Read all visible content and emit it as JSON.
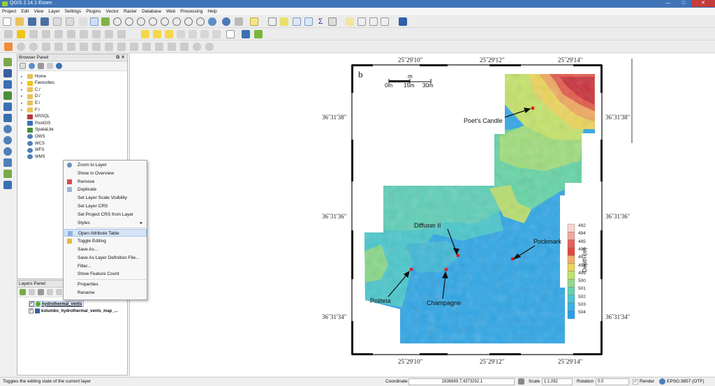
{
  "window": {
    "title": "QGIS 2.14.1-Essen",
    "min": "—",
    "max": "□",
    "close": "✕"
  },
  "menu": [
    "Project",
    "Edit",
    "View",
    "Layer",
    "Settings",
    "Plugins",
    "Vector",
    "Raster",
    "Database",
    "Web",
    "Processing",
    "Help"
  ],
  "browser_panel": {
    "title": "Browser Panel",
    "items": [
      {
        "label": "Home",
        "icon": "folder-icon",
        "color": "#e8c25a"
      },
      {
        "label": "Favourites",
        "icon": "star-icon",
        "color": "#f0c419"
      },
      {
        "label": "C:/",
        "icon": "folder-icon",
        "color": "#e8c25a"
      },
      {
        "label": "D:/",
        "icon": "folder-icon",
        "color": "#e8c25a"
      },
      {
        "label": "E:/",
        "icon": "folder-icon",
        "color": "#e8c25a"
      },
      {
        "label": "F:/",
        "icon": "folder-icon",
        "color": "#e8c25a"
      },
      {
        "label": "MSSQL",
        "icon": "database-icon",
        "color": "#b23a3a"
      },
      {
        "label": "PostGIS",
        "icon": "database-icon",
        "color": "#3a6fb2"
      },
      {
        "label": "SpatiaLite",
        "icon": "database-icon",
        "color": "#4a8f3a"
      },
      {
        "label": "OWS",
        "icon": "globe-icon",
        "color": "#4f7fb8"
      },
      {
        "label": "WCS",
        "icon": "globe-icon",
        "color": "#4f7fb8"
      },
      {
        "label": "WFS",
        "icon": "globe-icon",
        "color": "#4f7fb8"
      },
      {
        "label": "WMS",
        "icon": "globe-icon",
        "color": "#4f7fb8"
      }
    ]
  },
  "layers_panel": {
    "title": "Layers Panel",
    "layers": [
      {
        "name": "hydrothermal_vents",
        "checked": "✓",
        "selected": true
      },
      {
        "name": "kolumbo_hydrothermal_vents_map_...",
        "checked": "✓",
        "selected": false
      }
    ]
  },
  "context_menu": {
    "items": [
      {
        "label": "Zoom to Layer",
        "icon": "zoom-icon"
      },
      {
        "label": "Show in Overview",
        "icon": ""
      },
      {
        "label": "Remove",
        "icon": "remove-icon"
      },
      {
        "label": "Duplicate",
        "icon": "duplicate-icon"
      },
      {
        "label": "Set Layer Scale Visibility",
        "icon": ""
      },
      {
        "label": "Set Layer CRS",
        "icon": ""
      },
      {
        "label": "Set Project CRS from Layer",
        "icon": ""
      },
      {
        "label": "Styles",
        "icon": "",
        "submenu": "▸"
      },
      {
        "label": "Open Attribute Table",
        "icon": "table-icon",
        "highlighted": true
      },
      {
        "label": "Toggle Editing",
        "icon": "pencil-icon"
      },
      {
        "label": "Save As...",
        "icon": ""
      },
      {
        "label": "Save As Layer Definition File...",
        "icon": ""
      },
      {
        "label": "Filter...",
        "icon": ""
      },
      {
        "label": "Show Feature Count",
        "icon": ""
      },
      {
        "label": "Properties",
        "icon": ""
      },
      {
        "label": "Rename",
        "icon": ""
      }
    ]
  },
  "map": {
    "panel_letter": "b",
    "scale": {
      "unit": "m",
      "ticks": [
        "0m",
        "15m",
        "30m"
      ]
    },
    "top_lon": [
      "25˚29'10\"",
      "25˚29'12\"",
      "25˚29'14\""
    ],
    "bottom_lon": [
      "25˚29'10\"",
      "25˚29'12\"",
      "25˚29'14\""
    ],
    "left_lat": [
      "36˚31'38\"",
      "36˚31'36\"",
      "36˚31'34\""
    ],
    "right_lat": [
      "36˚31'38\"",
      "36˚31'36\"",
      "36˚31'34\""
    ],
    "labels": {
      "poets_candle": "Poet's Candle",
      "diffuser": "Diffuser II",
      "pockmark": "Pockmark",
      "politeia": "Politeia",
      "champagne": "Champagne"
    },
    "legend": {
      "title": "Depth (m)",
      "values": [
        "492",
        "494",
        "495",
        "496",
        "497",
        "498",
        "499",
        "500",
        "501",
        "502",
        "503",
        "504"
      ],
      "colors": [
        "#f8d3d0",
        "#f2a7a0",
        "#e86059",
        "#e4473d",
        "#f0b06c",
        "#e8d460",
        "#bfe36d",
        "#92d98a",
        "#67cfae",
        "#4dc6cf",
        "#3ab2e3",
        "#2a9ee8"
      ]
    },
    "vents_color": "#e02020"
  },
  "status": {
    "message": "Toggles the editing state of the current layer",
    "coordinate_label": "Coordinate",
    "coordinate_value": "2836889.7,4373292.1",
    "scale_label": "Scale",
    "scale_value": "1:1,082",
    "rotation_label": "Rotation",
    "rotation_value": "0.0",
    "render_label": "Render",
    "crs": "EPSG:3857 (OTF)"
  }
}
